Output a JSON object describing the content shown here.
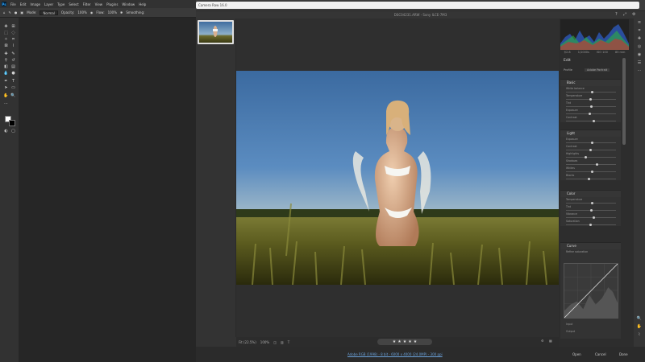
{
  "photoshop": {
    "logo": "Ps",
    "menu": [
      "File",
      "Edit",
      "Image",
      "Layer",
      "Type",
      "Select",
      "Filter",
      "View",
      "Plugins",
      "Window",
      "Help"
    ],
    "options": {
      "mode_label": "Mode:",
      "mode_value": "Normal",
      "opacity_label": "Opacity:",
      "opacity_value": "100%",
      "flow_label": "Flow:",
      "flow_value": "100%",
      "smoothing_label": "Smoothing:"
    },
    "colors": {
      "foreground": "#ffffff",
      "background": "#000000"
    }
  },
  "camera_raw": {
    "title": "Camera Raw 16.0",
    "subtitle": "DSC04231.ARW  -  Sony ILCE-7M3",
    "filmstrip": {
      "selected_index": 0
    },
    "bottom": {
      "fit": "Fit (22.5%)",
      "zoom": "100%",
      "stars": [
        "★",
        "★",
        "★",
        "★",
        "★"
      ]
    },
    "footer": {
      "info": "Adobe RGB (1998) - 8 bit - 6000 x 4000 (24.0MP) - 300 ppi",
      "open": "Open",
      "cancel": "Cancel",
      "done": "Done"
    },
    "panel": {
      "hist_tabs": [
        "f/2.8",
        "1/1000s",
        "ISO 100",
        "85 mm"
      ],
      "edit_label": "Edit",
      "profile_label": "Profile",
      "profile_value": "Adobe Portrait",
      "sections": [
        {
          "title": "Basic",
          "rows": [
            "White balance",
            "Temperature",
            "Tint",
            "Exposure",
            "Contrast"
          ]
        },
        {
          "title": "Light",
          "rows": [
            "Exposure",
            "Contrast",
            "Highlights",
            "Shadows",
            "Whites",
            "Blacks"
          ]
        },
        {
          "title": "Color",
          "rows": [
            "Temperature",
            "Tint",
            "Vibrance",
            "Saturation"
          ]
        },
        {
          "title": "Curve",
          "rows": [
            "Refine saturation",
            "Input",
            "Output"
          ]
        }
      ]
    },
    "accent": "#4a9ae8"
  }
}
